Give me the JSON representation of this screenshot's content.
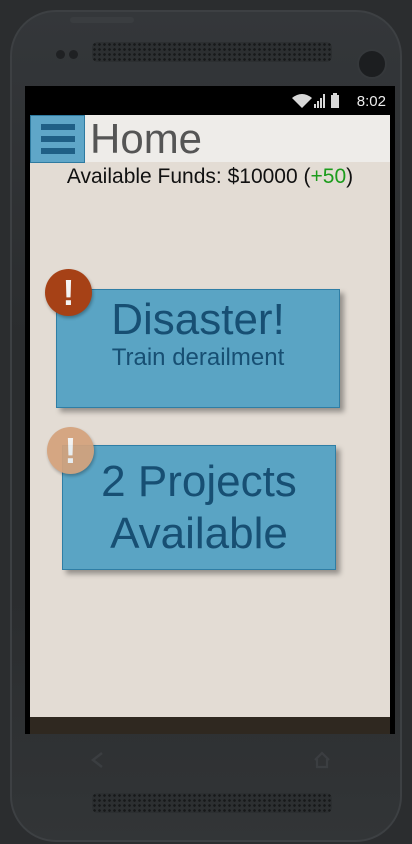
{
  "status": {
    "time": "8:02"
  },
  "header": {
    "title": "Home"
  },
  "funds": {
    "label": "Available Funds: $10000 (",
    "delta": "+50",
    "suffix": ")"
  },
  "cards": [
    {
      "badge": "!",
      "title": "Disaster!",
      "subtitle": "Train derailment",
      "badge_color": "#a64116"
    },
    {
      "badge": "!",
      "title_line1": "2 Projects",
      "title_line2": "Available",
      "badge_color": "#d4a27c"
    }
  ],
  "colors": {
    "card": "#5aa4c4",
    "card_text": "#174f73",
    "background": "#e3dcd4",
    "delta": "#1c9c1c"
  },
  "nav": {
    "back_icon": "back-icon",
    "home_icon": "home-icon"
  }
}
